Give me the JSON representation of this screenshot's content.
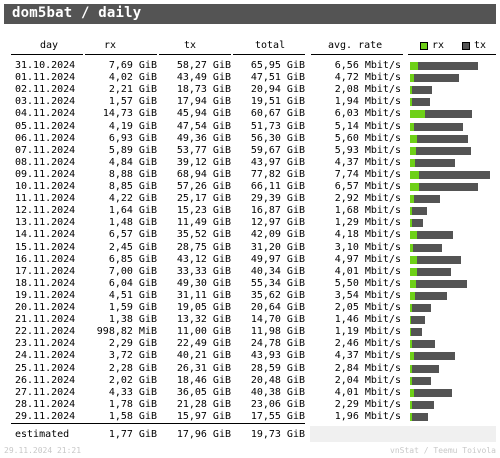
{
  "title": "dom5bat / daily",
  "headers": {
    "day": "day",
    "rx": "rx",
    "tx": "tx",
    "total": "total",
    "rate": "avg. rate",
    "legend_rx": "rx",
    "legend_tx": "tx"
  },
  "colors": {
    "rx": "#6ed018",
    "tx": "#545454",
    "title_bg": "#545454"
  },
  "rows": [
    {
      "day": "31.10.2024",
      "rx": "7,69 GiB",
      "tx": "58,27 GiB",
      "total": "65,95 GiB",
      "rate": "6,56 Mbit/s",
      "rx_v": 7.69,
      "tx_v": 58.27
    },
    {
      "day": "01.11.2024",
      "rx": "4,02 GiB",
      "tx": "43,49 GiB",
      "total": "47,51 GiB",
      "rate": "4,72 Mbit/s",
      "rx_v": 4.02,
      "tx_v": 43.49
    },
    {
      "day": "02.11.2024",
      "rx": "2,21 GiB",
      "tx": "18,73 GiB",
      "total": "20,94 GiB",
      "rate": "2,08 Mbit/s",
      "rx_v": 2.21,
      "tx_v": 18.73
    },
    {
      "day": "03.11.2024",
      "rx": "1,57 GiB",
      "tx": "17,94 GiB",
      "total": "19,51 GiB",
      "rate": "1,94 Mbit/s",
      "rx_v": 1.57,
      "tx_v": 17.94
    },
    {
      "day": "04.11.2024",
      "rx": "14,73 GiB",
      "tx": "45,94 GiB",
      "total": "60,67 GiB",
      "rate": "6,03 Mbit/s",
      "rx_v": 14.73,
      "tx_v": 45.94
    },
    {
      "day": "05.11.2024",
      "rx": "4,19 GiB",
      "tx": "47,54 GiB",
      "total": "51,73 GiB",
      "rate": "5,14 Mbit/s",
      "rx_v": 4.19,
      "tx_v": 47.54
    },
    {
      "day": "06.11.2024",
      "rx": "6,93 GiB",
      "tx": "49,36 GiB",
      "total": "56,30 GiB",
      "rate": "5,60 Mbit/s",
      "rx_v": 6.93,
      "tx_v": 49.36
    },
    {
      "day": "07.11.2024",
      "rx": "5,89 GiB",
      "tx": "53,77 GiB",
      "total": "59,67 GiB",
      "rate": "5,93 Mbit/s",
      "rx_v": 5.89,
      "tx_v": 53.77
    },
    {
      "day": "08.11.2024",
      "rx": "4,84 GiB",
      "tx": "39,12 GiB",
      "total": "43,97 GiB",
      "rate": "4,37 Mbit/s",
      "rx_v": 4.84,
      "tx_v": 39.12
    },
    {
      "day": "09.11.2024",
      "rx": "8,88 GiB",
      "tx": "68,94 GiB",
      "total": "77,82 GiB",
      "rate": "7,74 Mbit/s",
      "rx_v": 8.88,
      "tx_v": 68.94
    },
    {
      "day": "10.11.2024",
      "rx": "8,85 GiB",
      "tx": "57,26 GiB",
      "total": "66,11 GiB",
      "rate": "6,57 Mbit/s",
      "rx_v": 8.85,
      "tx_v": 57.26
    },
    {
      "day": "11.11.2024",
      "rx": "4,22 GiB",
      "tx": "25,17 GiB",
      "total": "29,39 GiB",
      "rate": "2,92 Mbit/s",
      "rx_v": 4.22,
      "tx_v": 25.17
    },
    {
      "day": "12.11.2024",
      "rx": "1,64 GiB",
      "tx": "15,23 GiB",
      "total": "16,87 GiB",
      "rate": "1,68 Mbit/s",
      "rx_v": 1.64,
      "tx_v": 15.23
    },
    {
      "day": "13.11.2024",
      "rx": "1,48 GiB",
      "tx": "11,49 GiB",
      "total": "12,97 GiB",
      "rate": "1,29 Mbit/s",
      "rx_v": 1.48,
      "tx_v": 11.49
    },
    {
      "day": "14.11.2024",
      "rx": "6,57 GiB",
      "tx": "35,52 GiB",
      "total": "42,09 GiB",
      "rate": "4,18 Mbit/s",
      "rx_v": 6.57,
      "tx_v": 35.52
    },
    {
      "day": "15.11.2024",
      "rx": "2,45 GiB",
      "tx": "28,75 GiB",
      "total": "31,20 GiB",
      "rate": "3,10 Mbit/s",
      "rx_v": 2.45,
      "tx_v": 28.75
    },
    {
      "day": "16.11.2024",
      "rx": "6,85 GiB",
      "tx": "43,12 GiB",
      "total": "49,97 GiB",
      "rate": "4,97 Mbit/s",
      "rx_v": 6.85,
      "tx_v": 43.12
    },
    {
      "day": "17.11.2024",
      "rx": "7,00 GiB",
      "tx": "33,33 GiB",
      "total": "40,34 GiB",
      "rate": "4,01 Mbit/s",
      "rx_v": 7.0,
      "tx_v": 33.33
    },
    {
      "day": "18.11.2024",
      "rx": "6,04 GiB",
      "tx": "49,30 GiB",
      "total": "55,34 GiB",
      "rate": "5,50 Mbit/s",
      "rx_v": 6.04,
      "tx_v": 49.3
    },
    {
      "day": "19.11.2024",
      "rx": "4,51 GiB",
      "tx": "31,11 GiB",
      "total": "35,62 GiB",
      "rate": "3,54 Mbit/s",
      "rx_v": 4.51,
      "tx_v": 31.11
    },
    {
      "day": "20.11.2024",
      "rx": "1,59 GiB",
      "tx": "19,05 GiB",
      "total": "20,64 GiB",
      "rate": "2,05 Mbit/s",
      "rx_v": 1.59,
      "tx_v": 19.05
    },
    {
      "day": "21.11.2024",
      "rx": "1,38 GiB",
      "tx": "13,32 GiB",
      "total": "14,70 GiB",
      "rate": "1,46 Mbit/s",
      "rx_v": 1.38,
      "tx_v": 13.32
    },
    {
      "day": "22.11.2024",
      "rx": "998,82 MiB",
      "tx": "11,00 GiB",
      "total": "11,98 GiB",
      "rate": "1,19 Mbit/s",
      "rx_v": 0.98,
      "tx_v": 11.0
    },
    {
      "day": "23.11.2024",
      "rx": "2,29 GiB",
      "tx": "22,49 GiB",
      "total": "24,78 GiB",
      "rate": "2,46 Mbit/s",
      "rx_v": 2.29,
      "tx_v": 22.49
    },
    {
      "day": "24.11.2024",
      "rx": "3,72 GiB",
      "tx": "40,21 GiB",
      "total": "43,93 GiB",
      "rate": "4,37 Mbit/s",
      "rx_v": 3.72,
      "tx_v": 40.21
    },
    {
      "day": "25.11.2024",
      "rx": "2,28 GiB",
      "tx": "26,31 GiB",
      "total": "28,59 GiB",
      "rate": "2,84 Mbit/s",
      "rx_v": 2.28,
      "tx_v": 26.31
    },
    {
      "day": "26.11.2024",
      "rx": "2,02 GiB",
      "tx": "18,46 GiB",
      "total": "20,48 GiB",
      "rate": "2,04 Mbit/s",
      "rx_v": 2.02,
      "tx_v": 18.46
    },
    {
      "day": "27.11.2024",
      "rx": "4,33 GiB",
      "tx": "36,05 GiB",
      "total": "40,38 GiB",
      "rate": "4,01 Mbit/s",
      "rx_v": 4.33,
      "tx_v": 36.05
    },
    {
      "day": "28.11.2024",
      "rx": "1,78 GiB",
      "tx": "21,28 GiB",
      "total": "23,06 GiB",
      "rate": "2,29 Mbit/s",
      "rx_v": 1.78,
      "tx_v": 21.28
    },
    {
      "day": "29.11.2024",
      "rx": "1,58 GiB",
      "tx": "15,97 GiB",
      "total": "17,55 GiB",
      "rate": "1,96 Mbit/s",
      "rx_v": 1.58,
      "tx_v": 15.97
    }
  ],
  "estimated": {
    "label": "estimated",
    "rx": "1,77 GiB",
    "tx": "17,96 GiB",
    "total": "19,73 GiB"
  },
  "footer": {
    "left": "29.11.2024 21:21",
    "right": "vnStat / Teemu Toivola"
  }
}
